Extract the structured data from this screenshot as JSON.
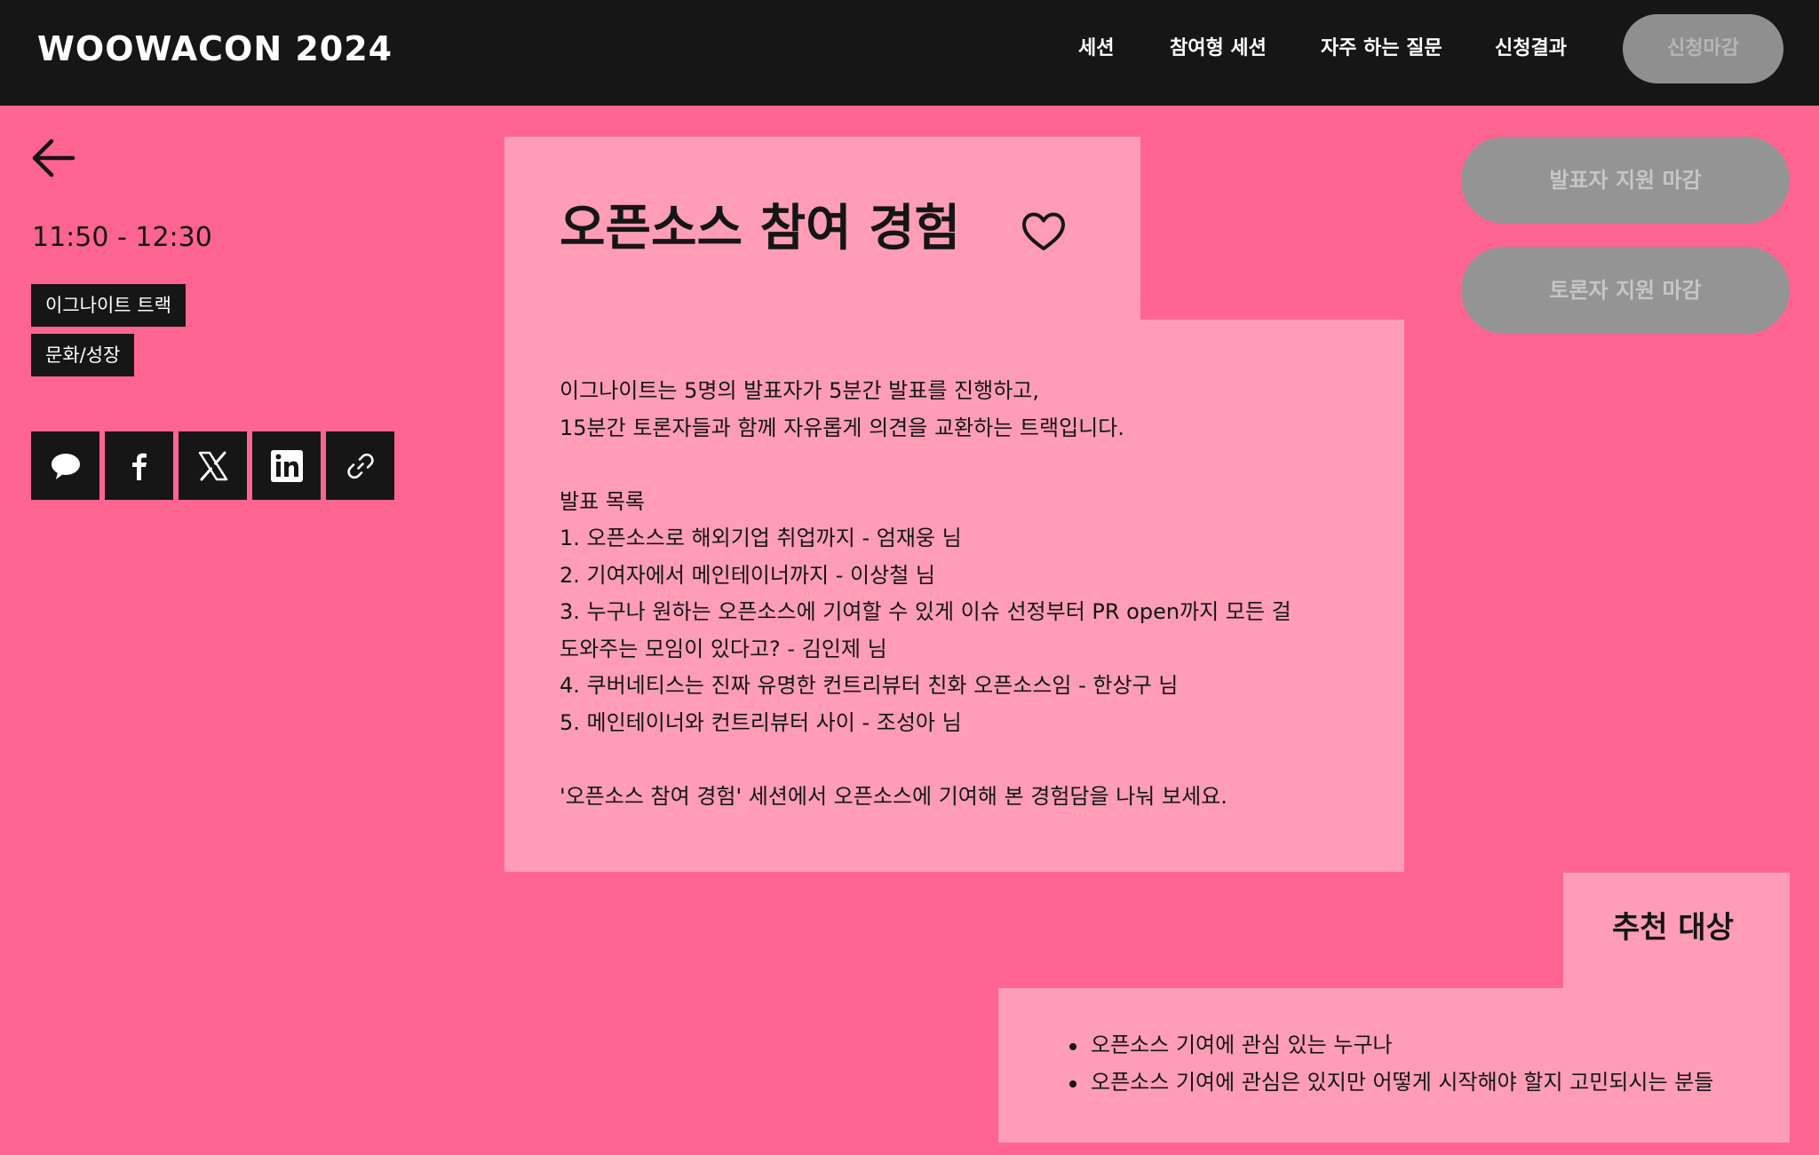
{
  "header": {
    "logo": "WOOWACON 2024",
    "nav": [
      "세션",
      "참여형 세션",
      "자주 하는 질문",
      "신청결과"
    ],
    "cta": "신청마감"
  },
  "session": {
    "time": "11:50 - 12:30",
    "tags": [
      "이그나이트 트랙",
      "문화/성장"
    ],
    "title": "오픈소스 참여 경험",
    "description_lines": [
      "이그나이트는 5명의 발표자가 5분간 발표를 진행하고,",
      "15분간 토론자들과 함께 자유롭게 의견을 교환하는 트랙입니다.",
      "",
      "발표 목록",
      "1. 오픈소스로 해외기업 취업까지 - 엄재웅 님",
      "2. 기여자에서 메인테이너까지 - 이상철 님",
      "3. 누구나 원하는 오픈소스에 기여할 수 있게 이슈 선정부터 PR open까지 모든 걸",
      "도와주는 모임이 있다고? - 김인제 님",
      "4. 쿠버네티스는 진짜 유명한 컨트리뷰터 친화 오픈소스임 - 한상구 님",
      "5. 메인테이너와 컨트리뷰터 사이 - 조성아 님",
      "",
      "'오픈소스 참여 경험' 세션에서 오픈소스에 기여해 본 경험담을 나눠 보세요."
    ]
  },
  "share_icons": [
    "speech-bubble-icon",
    "facebook-icon",
    "x-icon",
    "linkedin-icon",
    "link-icon"
  ],
  "actions": {
    "speaker_apply": "발표자 지원 마감",
    "panel_apply": "토론자 지원 마감"
  },
  "recommend": {
    "title": "추천 대상",
    "items": [
      "오픈소스 기여에 관심 있는 누구나",
      "오픈소스 기여에 관심은 있지만 어떻게 시작해야 할지 고민되시는 분들"
    ]
  },
  "colors": {
    "page_bg": "#ff6590",
    "card_bg": "#ff9db6",
    "header_bg": "#161616",
    "disabled_button": "#949494"
  }
}
